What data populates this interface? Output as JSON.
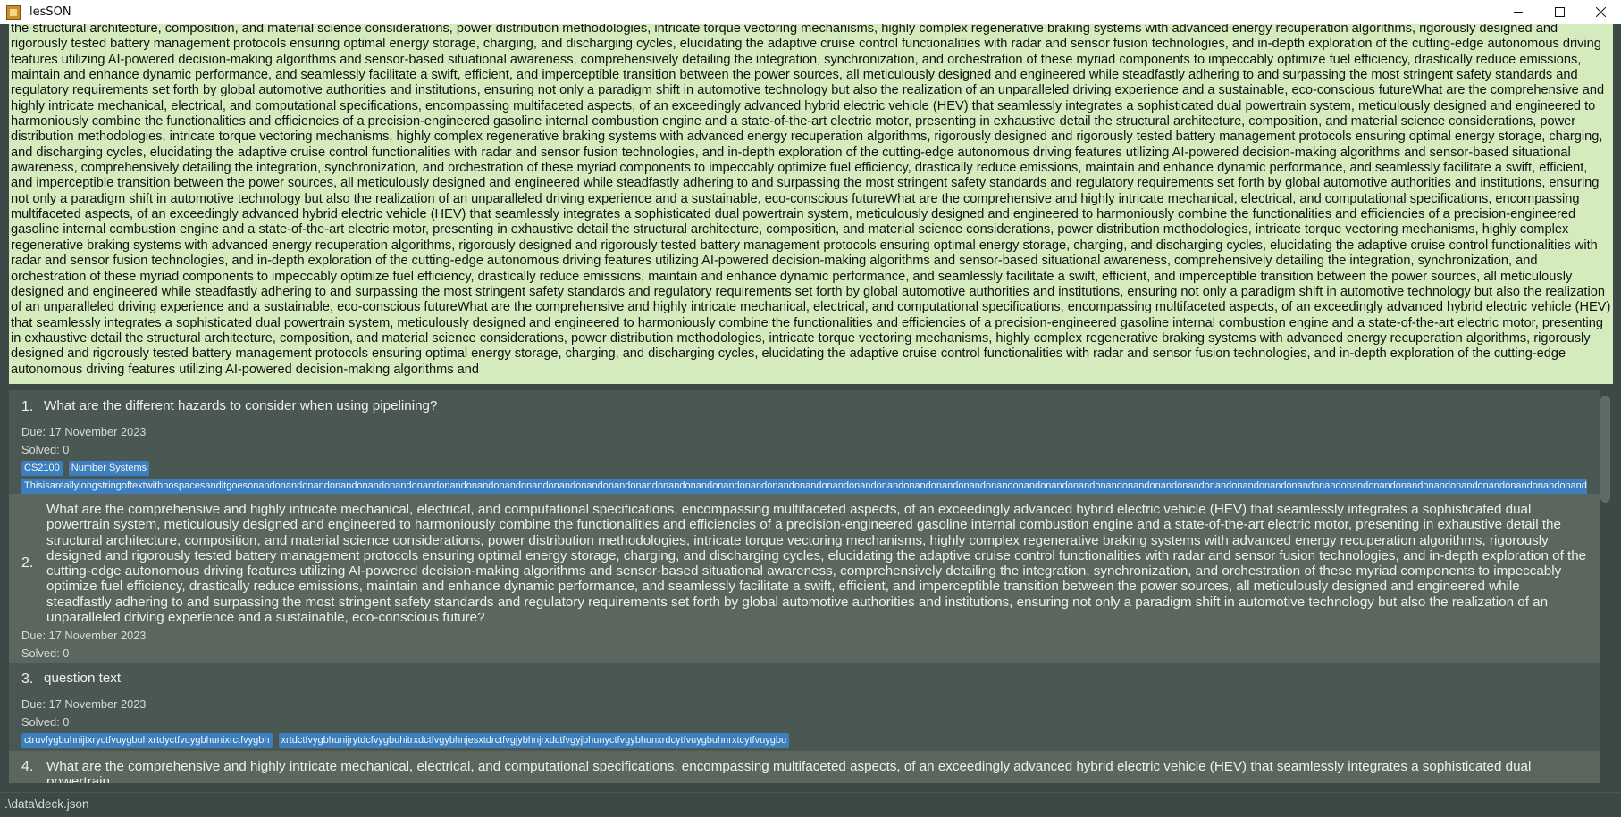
{
  "window": {
    "title": "lesSON"
  },
  "result_display": {
    "text": "the structural architecture, composition, and material science considerations, power distribution methodologies, intricate torque vectoring mechanisms, highly complex regenerative braking systems with advanced energy recuperation algorithms, rigorously designed and rigorously tested battery management protocols ensuring optimal energy storage, charging, and discharging cycles, elucidating the adaptive cruise control functionalities with radar and sensor fusion technologies, and in-depth exploration of the cutting-edge autonomous driving features utilizing AI-powered decision-making algorithms and sensor-based situational awareness, comprehensively detailing the integration, synchronization, and orchestration of these myriad components to impeccably optimize fuel efficiency, drastically reduce emissions, maintain and enhance dynamic performance, and seamlessly facilitate a swift, efficient, and imperceptible transition between the power sources, all meticulously designed and engineered while steadfastly adhering to and surpassing the most stringent safety standards and regulatory requirements set forth by global automotive authorities and institutions, ensuring not only a paradigm shift in automotive technology but also the realization of an unparalleled driving experience and a sustainable, eco-conscious futureWhat are the comprehensive and highly intricate mechanical, electrical, and computational specifications, encompassing multifaceted aspects, of an exceedingly advanced hybrid electric vehicle (HEV) that seamlessly integrates a sophisticated dual powertrain system, meticulously designed and engineered to harmoniously combine the functionalities and efficiencies of a precision-engineered gasoline internal combustion engine and a state-of-the-art electric motor, presenting in exhaustive detail the structural architecture, composition, and material science considerations, power distribution methodologies, intricate torque vectoring mechanisms, highly complex regenerative braking systems with advanced energy recuperation algorithms, rigorously designed and rigorously tested battery management protocols ensuring optimal energy storage, charging, and discharging cycles, elucidating the adaptive cruise control functionalities with radar and sensor fusion technologies, and in-depth exploration of the cutting-edge autonomous driving features utilizing AI-powered decision-making algorithms and sensor-based situational awareness, comprehensively detailing the integration, synchronization, and orchestration of these myriad components to impeccably optimize fuel efficiency, drastically reduce emissions, maintain and enhance dynamic performance, and seamlessly facilitate a swift, efficient, and imperceptible transition between the power sources, all meticulously designed and engineered while steadfastly adhering to and surpassing the most stringent safety standards and regulatory requirements set forth by global automotive authorities and institutions, ensuring not only a paradigm shift in automotive technology but also the realization of an unparalleled driving experience and a sustainable, eco-conscious futureWhat are the comprehensive and highly intricate mechanical, electrical, and computational specifications, encompassing multifaceted aspects, of an exceedingly advanced hybrid electric vehicle (HEV) that seamlessly integrates a sophisticated dual powertrain system, meticulously designed and engineered to harmoniously combine the functionalities and efficiencies of a precision-engineered gasoline internal combustion engine and a state-of-the-art electric motor, presenting in exhaustive detail the structural architecture, composition, and material science considerations, power distribution methodologies, intricate torque vectoring mechanisms, highly complex regenerative braking systems with advanced energy recuperation algorithms, rigorously designed and rigorously tested battery management protocols ensuring optimal energy storage, charging, and discharging cycles, elucidating the adaptive cruise control functionalities with radar and sensor fusion technologies, and in-depth exploration of the cutting-edge autonomous driving features utilizing AI-powered decision-making algorithms and sensor-based situational awareness, comprehensively detailing the integration, synchronization, and orchestration of these myriad components to impeccably optimize fuel efficiency, drastically reduce emissions, maintain and enhance dynamic performance, and seamlessly facilitate a swift, efficient, and imperceptible transition between the power sources, all meticulously designed and engineered while steadfastly adhering to and surpassing the most stringent safety standards and regulatory requirements set forth by global automotive authorities and institutions, ensuring not only a paradigm shift in automotive technology but also the realization of an unparalleled driving experience and a sustainable, eco-conscious futureWhat are the comprehensive and highly intricate mechanical, electrical, and computational specifications, encompassing multifaceted aspects, of an exceedingly advanced hybrid electric vehicle (HEV) that seamlessly integrates a sophisticated dual powertrain system, meticulously designed and engineered to harmoniously combine the functionalities and efficiencies of a precision-engineered gasoline internal combustion engine and a state-of-the-art electric motor, presenting in exhaustive detail the structural architecture, composition, and material science considerations, power distribution methodologies, intricate torque vectoring mechanisms, highly complex regenerative braking systems with advanced energy recuperation algorithms, rigorously designed and rigorously tested battery management protocols ensuring optimal energy storage, charging, and discharging cycles, elucidating the adaptive cruise control functionalities with radar and sensor fusion technologies, and in-depth exploration of the cutting-edge autonomous driving features utilizing AI-powered decision-making algorithms and"
  },
  "cards": [
    {
      "index": "1.",
      "question": "What are the different hazards to consider when using pipelining?",
      "due": "Due: 17 November 2023",
      "solved": "Solved: 0",
      "tags": [
        "CS2100",
        "Number Systems"
      ],
      "long_tag": "Thisisareallylongstringoftextwithnospacesanditgoesonandonandonandonandonandonandonandonandonandonandonandonandonandonandonandonandonandonandonandonandonandonandonandonandonandonandonandonandonandonandonandonandonandonandonandonandonandonandonandonandonandonandonandonandonandonandonandonandonandonandonandonandonandonandonandono"
    },
    {
      "index": "2.",
      "question": "What are the comprehensive and highly intricate mechanical, electrical, and computational specifications, encompassing multifaceted aspects, of an exceedingly advanced hybrid electric vehicle (HEV) that seamlessly integrates a sophisticated dual powertrain system, meticulously designed and engineered to harmoniously combine the functionalities and efficiencies of a precision-engineered gasoline internal combustion engine and a state-of-the-art electric motor, presenting in exhaustive detail the structural architecture, composition, and material science considerations, power distribution methodologies, intricate torque vectoring mechanisms, highly complex regenerative braking systems with advanced energy recuperation algorithms, rigorously designed and rigorously tested battery management protocols ensuring optimal energy storage, charging, and discharging cycles, elucidating the adaptive cruise control functionalities with radar and sensor fusion technologies, and in-depth exploration of the cutting-edge autonomous driving features utilizing AI-powered decision-making algorithms and sensor-based situational awareness, comprehensively detailing the integration, synchronization, and orchestration of these myriad components to impeccably optimize fuel efficiency, drastically reduce emissions, maintain and enhance dynamic performance, and seamlessly facilitate a swift, efficient, and imperceptible transition between the power sources, all meticulously designed and engineered while steadfastly adhering to and surpassing the most stringent safety standards and regulatory requirements set forth by global automotive authorities and institutions, ensuring not only a paradigm shift in automotive technology but also the realization of an unparalleled driving experience and a sustainable, eco-conscious future?",
      "due": "Due: 17 November 2023",
      "solved": "Solved: 0"
    },
    {
      "index": "3.",
      "question": "question text",
      "due": "Due: 17 November 2023",
      "solved": "Solved: 0",
      "tags": [
        "ctruvfygbuhnijtxryctfvuygbuhxrtdyctfvuygbhunixrctfvygbh",
        "xrtdctfvygbhunijrytdcfvygbuhitrxdctfvgybhnjesxtdrctfvgjybhnjrxdctfvgyjbhunyctfvgybhunxrdcytfvuygbuhnrxtcytfvuygbu"
      ]
    },
    {
      "index": "4.",
      "question": "What are the comprehensive and highly intricate mechanical, electrical, and computational specifications, encompassing multifaceted aspects, of an exceedingly advanced hybrid electric vehicle (HEV) that seamlessly integrates a sophisticated dual powertrain"
    }
  ],
  "status_bar": {
    "path": ".\\data\\deck.json"
  },
  "colors": {
    "result_bg": "#d3ebbd",
    "window_bg": "#3b4a47",
    "card_odd": "#4b5753",
    "card_even": "#5b665f",
    "tag_bg": "#3d7fbe"
  }
}
